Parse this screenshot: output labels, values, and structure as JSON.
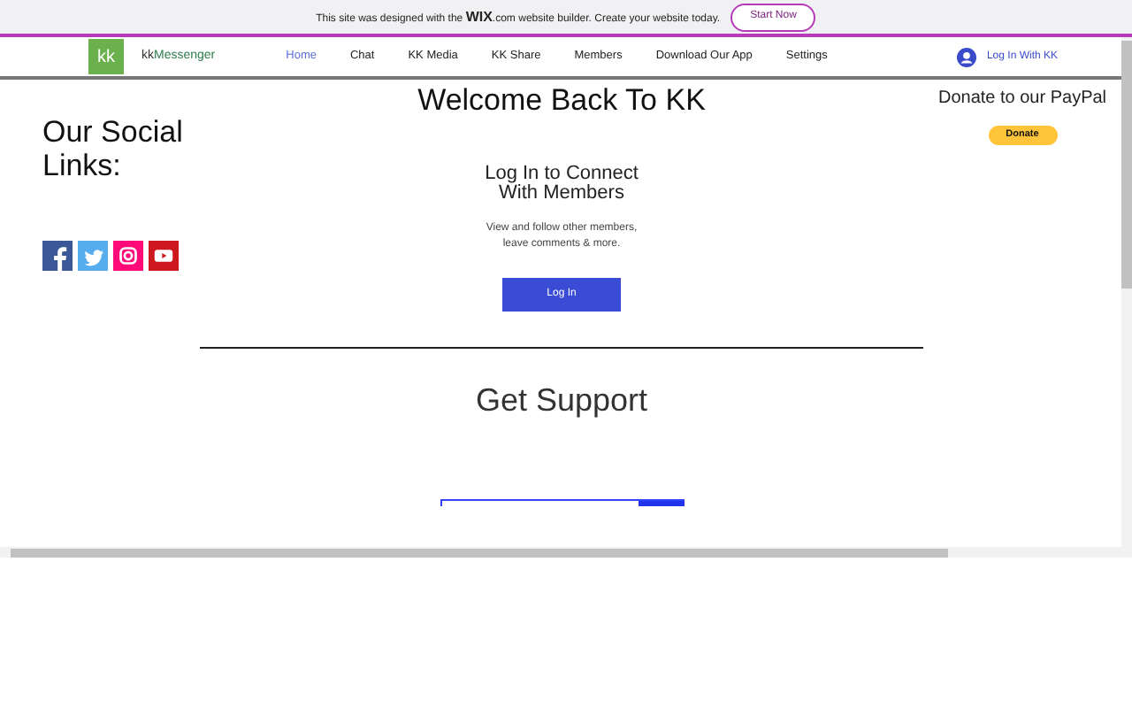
{
  "banner": {
    "text_before": "This site was designed with the",
    "brand": "WIX",
    "brand_suffix": ".com",
    "text_after": "website builder. Create your website today.",
    "button": "Start Now"
  },
  "header": {
    "logo": "kk",
    "site_name_prefix": "kk",
    "site_name": "Messenger",
    "login": "Log In With KK"
  },
  "nav": [
    {
      "label": "Home",
      "selected": true
    },
    {
      "label": "Chat",
      "selected": false
    },
    {
      "label": "KK Media",
      "selected": false
    },
    {
      "label": "KK Share",
      "selected": false
    },
    {
      "label": "Members",
      "selected": false
    },
    {
      "label": "Download Our App",
      "selected": false
    },
    {
      "label": "Settings",
      "selected": false
    }
  ],
  "social": {
    "title": "Our Social Links:",
    "links": [
      {
        "kind": "facebook",
        "color": "#3b5998"
      },
      {
        "kind": "twitter",
        "color": "#55acee"
      },
      {
        "kind": "instagram",
        "color": "#ff0a78"
      },
      {
        "kind": "youtube",
        "color": "#cc181e"
      }
    ]
  },
  "welcome": {
    "title": "Welcome Back To KK",
    "heading": "Log In to Connect With Members",
    "description": "View and follow other members, leave comments & more.",
    "button": "Log In"
  },
  "donate": {
    "title": "Donate to our PayPal",
    "button": "Donate"
  },
  "support": {
    "title": "Get Support"
  }
}
